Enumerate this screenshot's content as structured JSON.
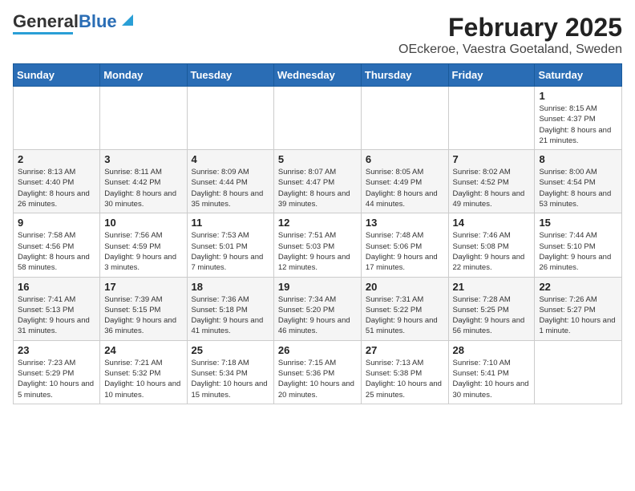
{
  "logo": {
    "text_general": "General",
    "text_blue": "Blue"
  },
  "title": {
    "month_year": "February 2025",
    "location": "OEckeroe, Vaestra Goetaland, Sweden"
  },
  "weekdays": [
    "Sunday",
    "Monday",
    "Tuesday",
    "Wednesday",
    "Thursday",
    "Friday",
    "Saturday"
  ],
  "weeks": [
    [
      {
        "date": "",
        "info": ""
      },
      {
        "date": "",
        "info": ""
      },
      {
        "date": "",
        "info": ""
      },
      {
        "date": "",
        "info": ""
      },
      {
        "date": "",
        "info": ""
      },
      {
        "date": "",
        "info": ""
      },
      {
        "date": "1",
        "info": "Sunrise: 8:15 AM\nSunset: 4:37 PM\nDaylight: 8 hours and 21 minutes."
      }
    ],
    [
      {
        "date": "2",
        "info": "Sunrise: 8:13 AM\nSunset: 4:40 PM\nDaylight: 8 hours and 26 minutes."
      },
      {
        "date": "3",
        "info": "Sunrise: 8:11 AM\nSunset: 4:42 PM\nDaylight: 8 hours and 30 minutes."
      },
      {
        "date": "4",
        "info": "Sunrise: 8:09 AM\nSunset: 4:44 PM\nDaylight: 8 hours and 35 minutes."
      },
      {
        "date": "5",
        "info": "Sunrise: 8:07 AM\nSunset: 4:47 PM\nDaylight: 8 hours and 39 minutes."
      },
      {
        "date": "6",
        "info": "Sunrise: 8:05 AM\nSunset: 4:49 PM\nDaylight: 8 hours and 44 minutes."
      },
      {
        "date": "7",
        "info": "Sunrise: 8:02 AM\nSunset: 4:52 PM\nDaylight: 8 hours and 49 minutes."
      },
      {
        "date": "8",
        "info": "Sunrise: 8:00 AM\nSunset: 4:54 PM\nDaylight: 8 hours and 53 minutes."
      }
    ],
    [
      {
        "date": "9",
        "info": "Sunrise: 7:58 AM\nSunset: 4:56 PM\nDaylight: 8 hours and 58 minutes."
      },
      {
        "date": "10",
        "info": "Sunrise: 7:56 AM\nSunset: 4:59 PM\nDaylight: 9 hours and 3 minutes."
      },
      {
        "date": "11",
        "info": "Sunrise: 7:53 AM\nSunset: 5:01 PM\nDaylight: 9 hours and 7 minutes."
      },
      {
        "date": "12",
        "info": "Sunrise: 7:51 AM\nSunset: 5:03 PM\nDaylight: 9 hours and 12 minutes."
      },
      {
        "date": "13",
        "info": "Sunrise: 7:48 AM\nSunset: 5:06 PM\nDaylight: 9 hours and 17 minutes."
      },
      {
        "date": "14",
        "info": "Sunrise: 7:46 AM\nSunset: 5:08 PM\nDaylight: 9 hours and 22 minutes."
      },
      {
        "date": "15",
        "info": "Sunrise: 7:44 AM\nSunset: 5:10 PM\nDaylight: 9 hours and 26 minutes."
      }
    ],
    [
      {
        "date": "16",
        "info": "Sunrise: 7:41 AM\nSunset: 5:13 PM\nDaylight: 9 hours and 31 minutes."
      },
      {
        "date": "17",
        "info": "Sunrise: 7:39 AM\nSunset: 5:15 PM\nDaylight: 9 hours and 36 minutes."
      },
      {
        "date": "18",
        "info": "Sunrise: 7:36 AM\nSunset: 5:18 PM\nDaylight: 9 hours and 41 minutes."
      },
      {
        "date": "19",
        "info": "Sunrise: 7:34 AM\nSunset: 5:20 PM\nDaylight: 9 hours and 46 minutes."
      },
      {
        "date": "20",
        "info": "Sunrise: 7:31 AM\nSunset: 5:22 PM\nDaylight: 9 hours and 51 minutes."
      },
      {
        "date": "21",
        "info": "Sunrise: 7:28 AM\nSunset: 5:25 PM\nDaylight: 9 hours and 56 minutes."
      },
      {
        "date": "22",
        "info": "Sunrise: 7:26 AM\nSunset: 5:27 PM\nDaylight: 10 hours and 1 minute."
      }
    ],
    [
      {
        "date": "23",
        "info": "Sunrise: 7:23 AM\nSunset: 5:29 PM\nDaylight: 10 hours and 5 minutes."
      },
      {
        "date": "24",
        "info": "Sunrise: 7:21 AM\nSunset: 5:32 PM\nDaylight: 10 hours and 10 minutes."
      },
      {
        "date": "25",
        "info": "Sunrise: 7:18 AM\nSunset: 5:34 PM\nDaylight: 10 hours and 15 minutes."
      },
      {
        "date": "26",
        "info": "Sunrise: 7:15 AM\nSunset: 5:36 PM\nDaylight: 10 hours and 20 minutes."
      },
      {
        "date": "27",
        "info": "Sunrise: 7:13 AM\nSunset: 5:38 PM\nDaylight: 10 hours and 25 minutes."
      },
      {
        "date": "28",
        "info": "Sunrise: 7:10 AM\nSunset: 5:41 PM\nDaylight: 10 hours and 30 minutes."
      },
      {
        "date": "",
        "info": ""
      }
    ]
  ]
}
